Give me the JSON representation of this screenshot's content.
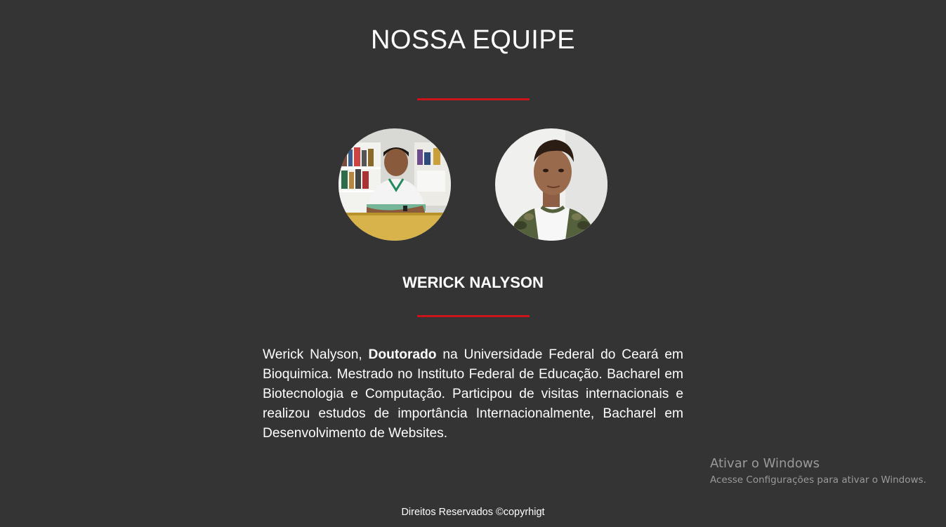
{
  "section": {
    "title": "NOSSA EQUIPE"
  },
  "team": {
    "members": [
      {
        "photo": "team-member-photo-1"
      },
      {
        "photo": "team-member-photo-2"
      }
    ],
    "selected_name": "WERICK NALYSON",
    "bio": {
      "lead": "Werick Nalyson, ",
      "highlight": "Doutorado",
      "rest": " na Universidade Federal do Ceará em Bioquimica. Mestrado no Instituto Federal de Educação. Bacharel em Biotecnologia e Computação. Participou de visitas internacionais e realizou estudos de importância Internacionalmente, Bacharel em Desenvolvimento de Websites."
    }
  },
  "watermark": {
    "title": "Ativar o Windows",
    "subtitle": "Acesse Configurações para ativar o Windows."
  },
  "footer": {
    "text": "Direitos Reservados ©copyrhigt"
  },
  "colors": {
    "background": "#343434",
    "accent": "#c8141a",
    "text": "#ffffff"
  }
}
